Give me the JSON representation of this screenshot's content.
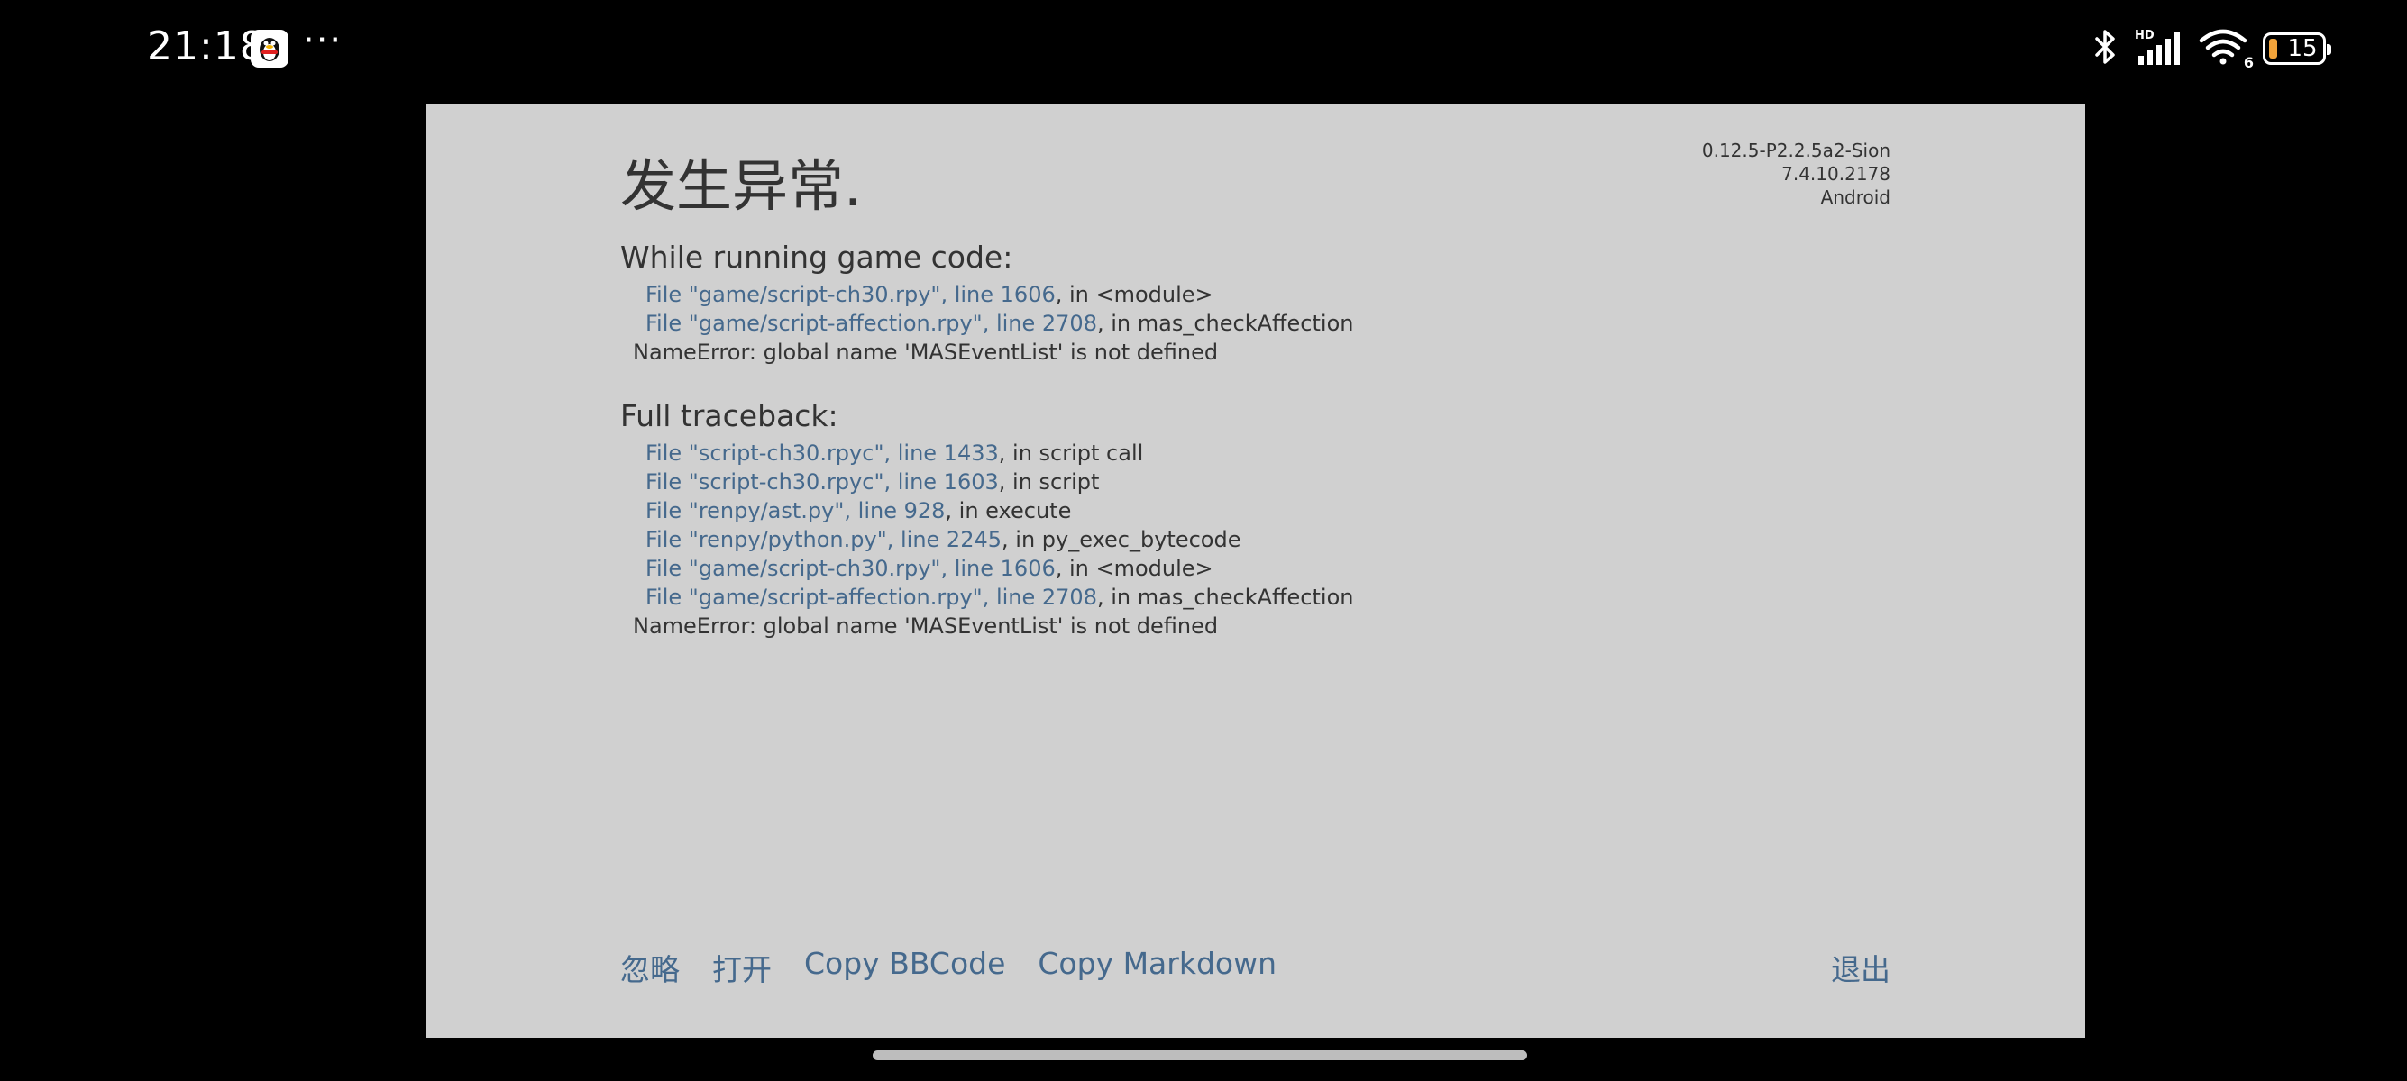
{
  "status_bar": {
    "time": "21:18",
    "app_icon": "qq-penguin-icon",
    "overflow": "···",
    "icons": [
      "bluetooth-icon",
      "hd-signal-icon",
      "wifi-icon"
    ],
    "wifi_badge": "6",
    "battery_level": "15",
    "battery_color": "#f2a33a"
  },
  "panel": {
    "title": "发生异常.",
    "version_lines": [
      "0.12.5-P2.2.5a2-Sion",
      "7.4.10.2178",
      "Android"
    ],
    "game_code": {
      "heading": "While running game code:",
      "frames": [
        {
          "file": "File \"game/script-ch30.rpy\", line 1606",
          "rest": ", in <module>"
        },
        {
          "file": "File \"game/script-affection.rpy\", line 2708",
          "rest": ", in mas_checkAffection"
        }
      ],
      "error": "NameError: global name 'MASEventList' is not defined"
    },
    "full_traceback": {
      "heading": "Full traceback:",
      "frames": [
        {
          "file": "File \"script-ch30.rpyc\", line 1433",
          "rest": ", in script call"
        },
        {
          "file": "File \"script-ch30.rpyc\", line 1603",
          "rest": ", in script"
        },
        {
          "file": "File \"renpy/ast.py\", line 928",
          "rest": ", in execute"
        },
        {
          "file": "File \"renpy/python.py\", line 2245",
          "rest": ", in py_exec_bytecode"
        },
        {
          "file": "File \"game/script-ch30.rpy\", line 1606",
          "rest": ", in <module>"
        },
        {
          "file": "File \"game/script-affection.rpy\", line 2708",
          "rest": ", in mas_checkAffection"
        }
      ],
      "error": "NameError: global name 'MASEventList' is not defined"
    },
    "actions": {
      "ignore": "忽略",
      "open": "打开",
      "copy_bbcode": "Copy BBCode",
      "copy_markdown": "Copy Markdown",
      "quit": "退出"
    },
    "link_color": "#45698d",
    "background": "#d0d0d0"
  }
}
